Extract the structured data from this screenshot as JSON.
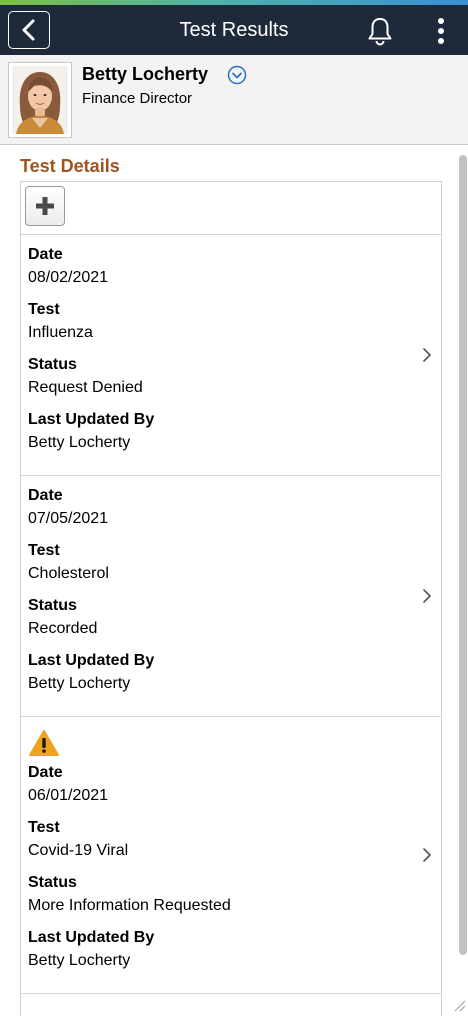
{
  "header": {
    "title": "Test Results"
  },
  "profile": {
    "name": "Betty Locherty",
    "role": "Finance Director"
  },
  "section": {
    "title": "Test Details"
  },
  "labels": {
    "date": "Date",
    "test": "Test",
    "status": "Status",
    "updated_by": "Last Updated By"
  },
  "rows": [
    {
      "date": "08/02/2021",
      "test": "Influenza",
      "status": "Request Denied",
      "updated_by": "Betty Locherty",
      "warning": false
    },
    {
      "date": "07/05/2021",
      "test": "Cholesterol",
      "status": "Recorded",
      "updated_by": "Betty Locherty",
      "warning": false
    },
    {
      "date": "06/01/2021",
      "test": "Covid-19 Viral",
      "status": "More Information Requested",
      "updated_by": "Betty Locherty",
      "warning": true
    }
  ],
  "icons": {
    "back": "back-arrow-icon",
    "notifications": "bell-icon",
    "menu": "more-vertical-icon",
    "add": "plus-icon",
    "warning": "warning-triangle-icon",
    "row_nav": "chevron-right-icon",
    "profile_menu": "chevron-down-circle-icon"
  },
  "colors": {
    "header_bg": "#1e2a3a",
    "section_title": "#a0541e",
    "warning": "#f0a31f"
  }
}
